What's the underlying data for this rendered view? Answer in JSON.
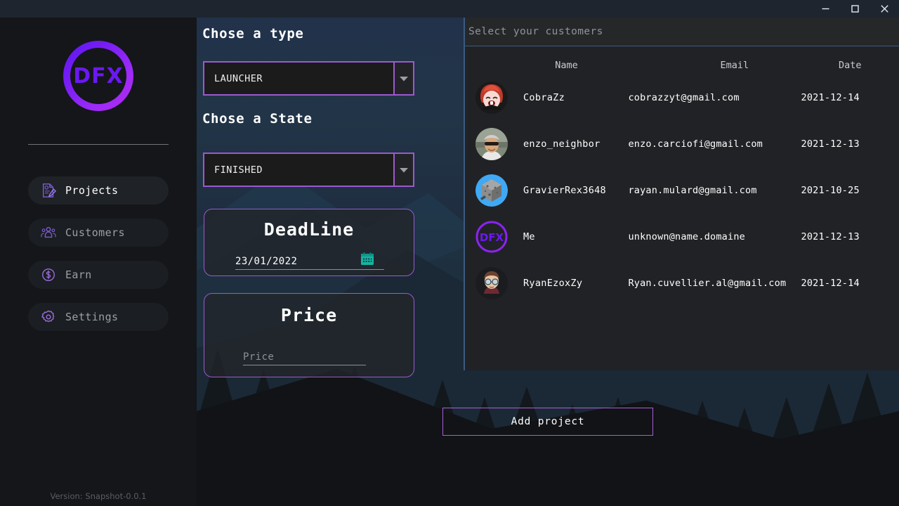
{
  "window": {
    "controls": [
      {
        "name": "minimize-button",
        "glyph": "minimize-icon"
      },
      {
        "name": "maximize-button",
        "glyph": "maximize-icon"
      },
      {
        "name": "close-button",
        "glyph": "close-icon"
      }
    ]
  },
  "sidebar": {
    "logo_text": "DFX",
    "items": [
      {
        "label": "Projects",
        "icon": "projects-icon",
        "active": true
      },
      {
        "label": "Customers",
        "icon": "customers-icon",
        "active": false
      },
      {
        "label": "Earn",
        "icon": "earn-icon",
        "active": false
      },
      {
        "label": "Settings",
        "icon": "settings-icon",
        "active": false
      }
    ],
    "version": "Version: Snapshot-0.0.1"
  },
  "form": {
    "type_label": "Chose a type",
    "type_value": "LAUNCHER",
    "state_label": "Chose a State",
    "state_value": "FINISHED",
    "deadline_title": "DeadLine",
    "deadline_value": "23/01/2022",
    "calendar_icon": "calendar-icon",
    "price_title": "Price",
    "price_placeholder": "Price"
  },
  "customers": {
    "header": "Select your customers",
    "columns": [
      "Name",
      "Email",
      "Date"
    ],
    "rows": [
      {
        "name": "CobraZz",
        "email": "cobrazzyt@gmail.com",
        "date": "2021-12-14",
        "avatar": "avatar-cobrazz"
      },
      {
        "name": "enzo_neighbor",
        "email": "enzo.carciofi@gmail.com",
        "date": "2021-12-13",
        "avatar": "avatar-enzo"
      },
      {
        "name": "GravierRex3648",
        "email": "rayan.mulard@gmail.com",
        "date": "2021-10-25",
        "avatar": "avatar-gravier"
      },
      {
        "name": "Me",
        "email": "unknown@name.domaine",
        "date": "2021-12-13",
        "avatar": "avatar-me"
      },
      {
        "name": "RyanEzoxZy",
        "email": "Ryan.cuvellier.al@gmail.com",
        "date": "2021-12-14",
        "avatar": "avatar-ryan"
      }
    ]
  },
  "actions": {
    "add_project": "Add project"
  },
  "colors": {
    "accent_purple": "#9b59d0",
    "logo_gradient_start": "#5b16f0",
    "logo_gradient_end": "#b429f0",
    "calendar_teal": "#17b3a3",
    "panel_bg": "#212225",
    "sidebar_bg": "#141619",
    "titlebar_bg": "#1e252e"
  }
}
